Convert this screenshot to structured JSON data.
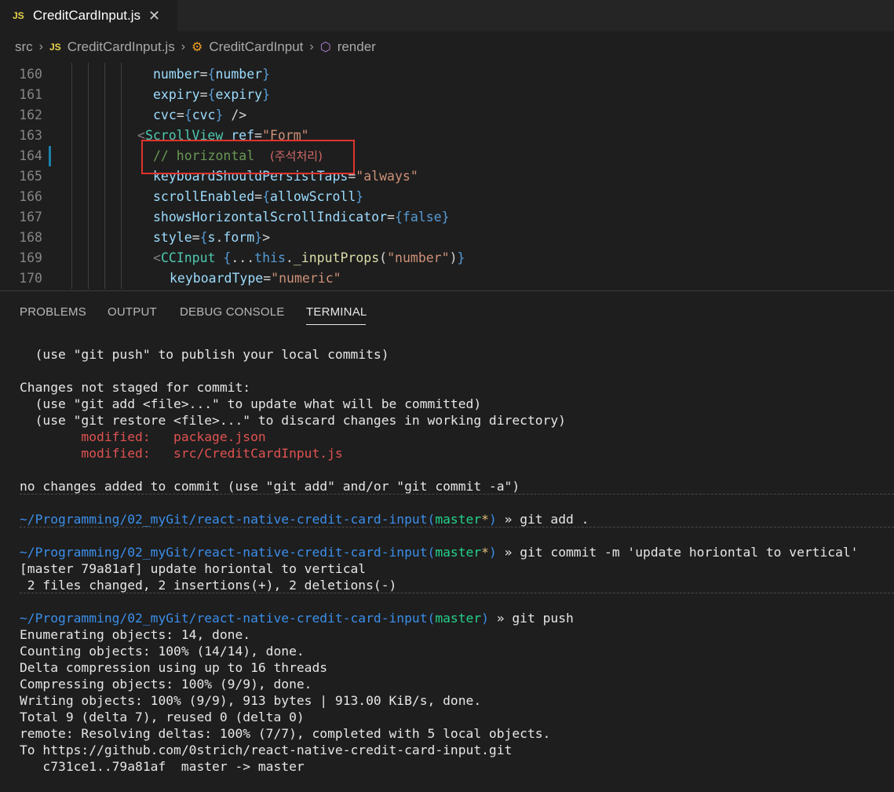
{
  "tab": {
    "icon": "JS",
    "title": "CreditCardInput.js",
    "close": "✕"
  },
  "breadcrumb": {
    "items": [
      "src",
      "CreditCardInput.js",
      "CreditCardInput",
      "render"
    ],
    "file_icon": "JS"
  },
  "editor": {
    "lines": [
      {
        "num": "160",
        "parts": [
          [
            "attr",
            "number"
          ],
          [
            "punc",
            "="
          ],
          [
            "brace",
            "{"
          ],
          [
            "var",
            "number"
          ],
          [
            "brace",
            "}"
          ]
        ]
      },
      {
        "num": "161",
        "parts": [
          [
            "attr",
            "expiry"
          ],
          [
            "punc",
            "="
          ],
          [
            "brace",
            "{"
          ],
          [
            "var",
            "expiry"
          ],
          [
            "brace",
            "}"
          ]
        ]
      },
      {
        "num": "162",
        "parts": [
          [
            "attr",
            "cvc"
          ],
          [
            "punc",
            "="
          ],
          [
            "brace",
            "{"
          ],
          [
            "var",
            "cvc"
          ],
          [
            "brace",
            "}"
          ],
          [
            "punc",
            " />"
          ]
        ]
      },
      {
        "num": "163",
        "parts": [
          [
            "gray",
            "<"
          ],
          [
            "tag",
            "ScrollView"
          ],
          [
            "punc",
            " "
          ],
          [
            "attr",
            "ref"
          ],
          [
            "punc",
            "="
          ],
          [
            "str",
            "\"Form\""
          ]
        ]
      },
      {
        "num": "164",
        "parts": [
          [
            "comment",
            "// horizontal  "
          ],
          [
            "kr",
            "(주석처리)"
          ]
        ]
      },
      {
        "num": "165",
        "parts": [
          [
            "attr",
            "keyboardShouldPersistTaps"
          ],
          [
            "punc",
            "="
          ],
          [
            "str",
            "\"always\""
          ]
        ]
      },
      {
        "num": "166",
        "parts": [
          [
            "attr",
            "scrollEnabled"
          ],
          [
            "punc",
            "="
          ],
          [
            "brace",
            "{"
          ],
          [
            "var",
            "allowScroll"
          ],
          [
            "brace",
            "}"
          ]
        ]
      },
      {
        "num": "167",
        "parts": [
          [
            "attr",
            "showsHorizontalScrollIndicator"
          ],
          [
            "punc",
            "="
          ],
          [
            "brace",
            "{"
          ],
          [
            "kw",
            "false"
          ],
          [
            "brace",
            "}"
          ]
        ]
      },
      {
        "num": "168",
        "parts": [
          [
            "attr",
            "style"
          ],
          [
            "punc",
            "="
          ],
          [
            "brace",
            "{"
          ],
          [
            "var",
            "s"
          ],
          [
            "punc",
            "."
          ],
          [
            "var",
            "form"
          ],
          [
            "brace",
            "}"
          ],
          [
            "punc",
            ">"
          ]
        ]
      },
      {
        "num": "169",
        "parts": [
          [
            "gray",
            "<"
          ],
          [
            "tag",
            "CCInput"
          ],
          [
            "punc",
            " "
          ],
          [
            "brace",
            "{"
          ],
          [
            "punc",
            "..."
          ],
          [
            "kw",
            "this"
          ],
          [
            "punc",
            "."
          ],
          [
            "fn",
            "_inputProps"
          ],
          [
            "punc",
            "("
          ],
          [
            "str",
            "\"number\""
          ],
          [
            "punc",
            ")"
          ],
          [
            "brace",
            "}"
          ]
        ]
      },
      {
        "num": "170",
        "parts": [
          [
            "attr",
            "keyboardType"
          ],
          [
            "punc",
            "="
          ],
          [
            "str",
            "\"numeric\""
          ]
        ]
      }
    ]
  },
  "panel": {
    "tabs": [
      "PROBLEMS",
      "OUTPUT",
      "DEBUG CONSOLE",
      "TERMINAL"
    ],
    "active_tab": "TERMINAL"
  },
  "terminal": {
    "prompt_path": "~/Programming/02_myGit/react-native-credit-card-input",
    "lines": [
      {
        "parts": [
          [
            "n",
            "  (use \"git push\" to publish your local commits)"
          ]
        ]
      },
      {
        "parts": [
          [
            "n",
            "Changes not staged for commit:"
          ]
        ]
      },
      {
        "parts": [
          [
            "n",
            "  (use \"git add <file>...\" to update what will be committed)"
          ]
        ]
      },
      {
        "parts": [
          [
            "n",
            "  (use \"git restore <file>...\" to discard changes in working directory)"
          ]
        ]
      },
      {
        "parts": [
          [
            "r",
            "        modified:   package.json"
          ]
        ]
      },
      {
        "parts": [
          [
            "r",
            "        modified:   src/CreditCardInput.js"
          ]
        ]
      },
      {
        "parts": [
          [
            "n",
            "no changes added to commit (use \"git add\" and/or \"git commit -a\")"
          ]
        ]
      },
      {
        "parts": [
          [
            "b",
            "~/Programming/02_myGit/react-native-credit-card-input"
          ],
          [
            "b",
            "("
          ],
          [
            "g",
            "master"
          ],
          [
            "y",
            "*"
          ],
          [
            "b",
            ")"
          ],
          [
            "n",
            " » git add ."
          ]
        ]
      },
      {
        "parts": [
          [
            "b",
            "~/Programming/02_myGit/react-native-credit-card-input"
          ],
          [
            "b",
            "("
          ],
          [
            "g",
            "master"
          ],
          [
            "y",
            "*"
          ],
          [
            "b",
            ")"
          ],
          [
            "n",
            " » git commit -m 'update horiontal to vertical'"
          ]
        ]
      },
      {
        "parts": [
          [
            "n",
            "[master 79a81af] update horiontal to vertical"
          ]
        ]
      },
      {
        "parts": [
          [
            "n",
            " 2 files changed, 2 insertions(+), 2 deletions(-)"
          ]
        ]
      },
      {
        "parts": [
          [
            "b",
            "~/Programming/02_myGit/react-native-credit-card-input"
          ],
          [
            "b",
            "("
          ],
          [
            "g",
            "master"
          ],
          [
            "b",
            ")"
          ],
          [
            "n",
            " » git push"
          ]
        ]
      },
      {
        "parts": [
          [
            "n",
            "Enumerating objects: 14, done."
          ]
        ]
      },
      {
        "parts": [
          [
            "n",
            "Counting objects: 100% (14/14), done."
          ]
        ]
      },
      {
        "parts": [
          [
            "n",
            "Delta compression using up to 16 threads"
          ]
        ]
      },
      {
        "parts": [
          [
            "n",
            "Compressing objects: 100% (9/9), done."
          ]
        ]
      },
      {
        "parts": [
          [
            "n",
            "Writing objects: 100% (9/9), 913 bytes | 913.00 KiB/s, done."
          ]
        ]
      },
      {
        "parts": [
          [
            "n",
            "Total 9 (delta 7), reused 0 (delta 0)"
          ]
        ]
      },
      {
        "parts": [
          [
            "n",
            "remote: Resolving deltas: 100% (7/7), completed with 5 local objects."
          ]
        ]
      },
      {
        "parts": [
          [
            "n",
            "To https://github.com/0strich/react-native-credit-card-input.git"
          ]
        ]
      },
      {
        "parts": [
          [
            "n",
            "   c731ce1..79a81af  master -> master"
          ]
        ]
      }
    ]
  }
}
